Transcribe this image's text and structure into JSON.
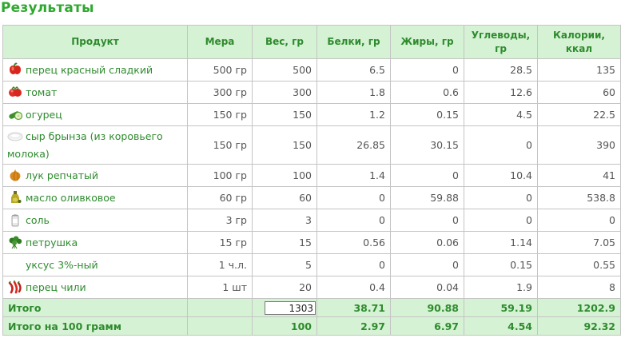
{
  "title": "Результаты",
  "columns": [
    "Продукт",
    "Мера",
    "Вес, гр",
    "Белки, гр",
    "Жиры, гр",
    "Углеводы, гр",
    "Калории, ккал"
  ],
  "rows": [
    {
      "icon": "red-pepper-icon",
      "name": "перец красный сладкий",
      "measure": "500 гр",
      "weight": "500",
      "protein": "6.5",
      "fat": "0",
      "carbs": "28.5",
      "kcal": "135"
    },
    {
      "icon": "tomato-icon",
      "name": "томат",
      "measure": "300 гр",
      "weight": "300",
      "protein": "1.8",
      "fat": "0.6",
      "carbs": "12.6",
      "kcal": "60"
    },
    {
      "icon": "cucumber-icon",
      "name": "огурец",
      "measure": "150 гр",
      "weight": "150",
      "protein": "1.2",
      "fat": "0.15",
      "carbs": "4.5",
      "kcal": "22.5"
    },
    {
      "icon": "cheese-icon",
      "name": "сыр брынза (из коровьего молока)",
      "measure": "150 гр",
      "weight": "150",
      "protein": "26.85",
      "fat": "30.15",
      "carbs": "0",
      "kcal": "390"
    },
    {
      "icon": "onion-icon",
      "name": "лук репчатый",
      "measure": "100 гр",
      "weight": "100",
      "protein": "1.4",
      "fat": "0",
      "carbs": "10.4",
      "kcal": "41"
    },
    {
      "icon": "olive-oil-icon",
      "name": "масло оливковое",
      "measure": "60 гр",
      "weight": "60",
      "protein": "0",
      "fat": "59.88",
      "carbs": "0",
      "kcal": "538.8"
    },
    {
      "icon": "salt-icon",
      "name": "соль",
      "measure": "3 гр",
      "weight": "3",
      "protein": "0",
      "fat": "0",
      "carbs": "0",
      "kcal": "0"
    },
    {
      "icon": "parsley-icon",
      "name": "петрушка",
      "measure": "15 гр",
      "weight": "15",
      "protein": "0.56",
      "fat": "0.06",
      "carbs": "1.14",
      "kcal": "7.05"
    },
    {
      "icon": "",
      "name": "уксус 3%-ный",
      "measure": "1 ч.л.",
      "weight": "5",
      "protein": "0",
      "fat": "0",
      "carbs": "0.15",
      "kcal": "0.55"
    },
    {
      "icon": "chili-icon",
      "name": "перец чили",
      "measure": "1 шт",
      "weight": "20",
      "protein": "0.4",
      "fat": "0.04",
      "carbs": "1.9",
      "kcal": "8"
    }
  ],
  "total": {
    "label": "Итого",
    "weight": "1303",
    "protein": "38.71",
    "fat": "90.88",
    "carbs": "59.19",
    "kcal": "1202.9"
  },
  "per100": {
    "label": "Итого на 100 грамм",
    "weight": "100",
    "protein": "2.97",
    "fat": "6.97",
    "carbs": "4.54",
    "kcal": "92.32"
  },
  "colors": {
    "accent": "#2e8b2e",
    "title": "#2ea82e",
    "header_bg": "#d6f2d4",
    "border": "#c4c4c4",
    "text": "#555555"
  }
}
